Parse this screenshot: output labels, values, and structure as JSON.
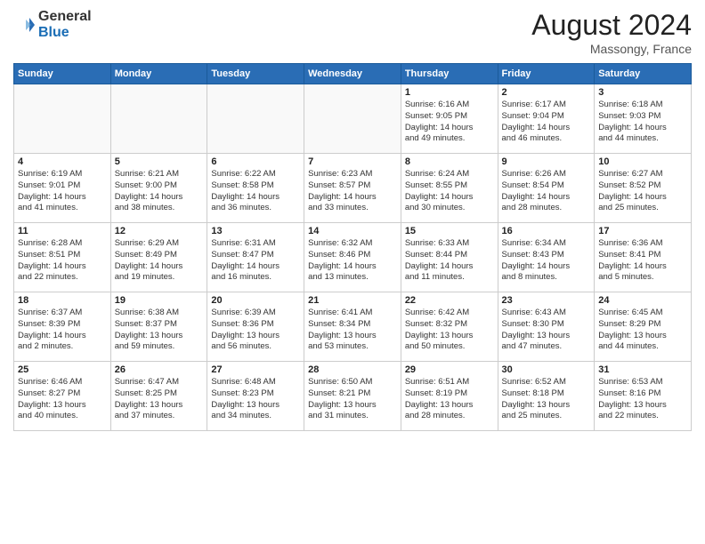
{
  "header": {
    "logo_line1": "General",
    "logo_line2": "Blue",
    "month_title": "August 2024",
    "location": "Massongy, France"
  },
  "weekdays": [
    "Sunday",
    "Monday",
    "Tuesday",
    "Wednesday",
    "Thursday",
    "Friday",
    "Saturday"
  ],
  "weeks": [
    [
      {
        "day": "",
        "info": ""
      },
      {
        "day": "",
        "info": ""
      },
      {
        "day": "",
        "info": ""
      },
      {
        "day": "",
        "info": ""
      },
      {
        "day": "1",
        "info": "Sunrise: 6:16 AM\nSunset: 9:05 PM\nDaylight: 14 hours\nand 49 minutes."
      },
      {
        "day": "2",
        "info": "Sunrise: 6:17 AM\nSunset: 9:04 PM\nDaylight: 14 hours\nand 46 minutes."
      },
      {
        "day": "3",
        "info": "Sunrise: 6:18 AM\nSunset: 9:03 PM\nDaylight: 14 hours\nand 44 minutes."
      }
    ],
    [
      {
        "day": "4",
        "info": "Sunrise: 6:19 AM\nSunset: 9:01 PM\nDaylight: 14 hours\nand 41 minutes."
      },
      {
        "day": "5",
        "info": "Sunrise: 6:21 AM\nSunset: 9:00 PM\nDaylight: 14 hours\nand 38 minutes."
      },
      {
        "day": "6",
        "info": "Sunrise: 6:22 AM\nSunset: 8:58 PM\nDaylight: 14 hours\nand 36 minutes."
      },
      {
        "day": "7",
        "info": "Sunrise: 6:23 AM\nSunset: 8:57 PM\nDaylight: 14 hours\nand 33 minutes."
      },
      {
        "day": "8",
        "info": "Sunrise: 6:24 AM\nSunset: 8:55 PM\nDaylight: 14 hours\nand 30 minutes."
      },
      {
        "day": "9",
        "info": "Sunrise: 6:26 AM\nSunset: 8:54 PM\nDaylight: 14 hours\nand 28 minutes."
      },
      {
        "day": "10",
        "info": "Sunrise: 6:27 AM\nSunset: 8:52 PM\nDaylight: 14 hours\nand 25 minutes."
      }
    ],
    [
      {
        "day": "11",
        "info": "Sunrise: 6:28 AM\nSunset: 8:51 PM\nDaylight: 14 hours\nand 22 minutes."
      },
      {
        "day": "12",
        "info": "Sunrise: 6:29 AM\nSunset: 8:49 PM\nDaylight: 14 hours\nand 19 minutes."
      },
      {
        "day": "13",
        "info": "Sunrise: 6:31 AM\nSunset: 8:47 PM\nDaylight: 14 hours\nand 16 minutes."
      },
      {
        "day": "14",
        "info": "Sunrise: 6:32 AM\nSunset: 8:46 PM\nDaylight: 14 hours\nand 13 minutes."
      },
      {
        "day": "15",
        "info": "Sunrise: 6:33 AM\nSunset: 8:44 PM\nDaylight: 14 hours\nand 11 minutes."
      },
      {
        "day": "16",
        "info": "Sunrise: 6:34 AM\nSunset: 8:43 PM\nDaylight: 14 hours\nand 8 minutes."
      },
      {
        "day": "17",
        "info": "Sunrise: 6:36 AM\nSunset: 8:41 PM\nDaylight: 14 hours\nand 5 minutes."
      }
    ],
    [
      {
        "day": "18",
        "info": "Sunrise: 6:37 AM\nSunset: 8:39 PM\nDaylight: 14 hours\nand 2 minutes."
      },
      {
        "day": "19",
        "info": "Sunrise: 6:38 AM\nSunset: 8:37 PM\nDaylight: 13 hours\nand 59 minutes."
      },
      {
        "day": "20",
        "info": "Sunrise: 6:39 AM\nSunset: 8:36 PM\nDaylight: 13 hours\nand 56 minutes."
      },
      {
        "day": "21",
        "info": "Sunrise: 6:41 AM\nSunset: 8:34 PM\nDaylight: 13 hours\nand 53 minutes."
      },
      {
        "day": "22",
        "info": "Sunrise: 6:42 AM\nSunset: 8:32 PM\nDaylight: 13 hours\nand 50 minutes."
      },
      {
        "day": "23",
        "info": "Sunrise: 6:43 AM\nSunset: 8:30 PM\nDaylight: 13 hours\nand 47 minutes."
      },
      {
        "day": "24",
        "info": "Sunrise: 6:45 AM\nSunset: 8:29 PM\nDaylight: 13 hours\nand 44 minutes."
      }
    ],
    [
      {
        "day": "25",
        "info": "Sunrise: 6:46 AM\nSunset: 8:27 PM\nDaylight: 13 hours\nand 40 minutes."
      },
      {
        "day": "26",
        "info": "Sunrise: 6:47 AM\nSunset: 8:25 PM\nDaylight: 13 hours\nand 37 minutes."
      },
      {
        "day": "27",
        "info": "Sunrise: 6:48 AM\nSunset: 8:23 PM\nDaylight: 13 hours\nand 34 minutes."
      },
      {
        "day": "28",
        "info": "Sunrise: 6:50 AM\nSunset: 8:21 PM\nDaylight: 13 hours\nand 31 minutes."
      },
      {
        "day": "29",
        "info": "Sunrise: 6:51 AM\nSunset: 8:19 PM\nDaylight: 13 hours\nand 28 minutes."
      },
      {
        "day": "30",
        "info": "Sunrise: 6:52 AM\nSunset: 8:18 PM\nDaylight: 13 hours\nand 25 minutes."
      },
      {
        "day": "31",
        "info": "Sunrise: 6:53 AM\nSunset: 8:16 PM\nDaylight: 13 hours\nand 22 minutes."
      }
    ]
  ]
}
